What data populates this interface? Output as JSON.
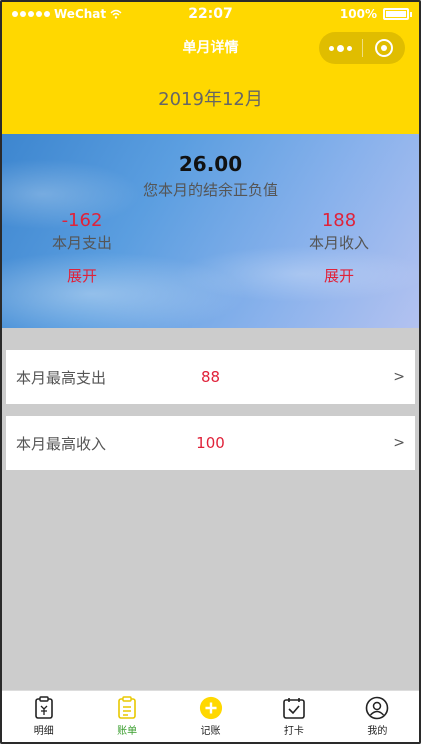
{
  "status_bar": {
    "carrier": "WeChat",
    "time": "22:07",
    "battery": "100%"
  },
  "nav": {
    "title": "单月详情"
  },
  "header": {
    "month": "2019年12月"
  },
  "summary": {
    "balance": "26.00",
    "balance_label": "您本月的结余正负值",
    "expense": {
      "value": "-162",
      "label": "本月支出",
      "expand": "展开"
    },
    "income": {
      "value": "188",
      "label": "本月收入",
      "expand": "展开"
    }
  },
  "stats": [
    {
      "label": "本月最高支出",
      "value": "88",
      "arrow": ">"
    },
    {
      "label": "本月最高收入",
      "value": "100",
      "arrow": ">"
    }
  ],
  "tabbar": {
    "items": [
      {
        "label": "明细",
        "icon": "receipt-icon"
      },
      {
        "label": "账单",
        "icon": "clipboard-icon",
        "active": true
      },
      {
        "label": "记账",
        "icon": "plus-circle-icon"
      },
      {
        "label": "打卡",
        "icon": "calendar-check-icon"
      },
      {
        "label": "我的",
        "icon": "user-icon"
      }
    ]
  },
  "colors": {
    "brand_yellow": "#ffd800",
    "amount_red": "#e0223a",
    "active_green": "#3a9e2e"
  }
}
